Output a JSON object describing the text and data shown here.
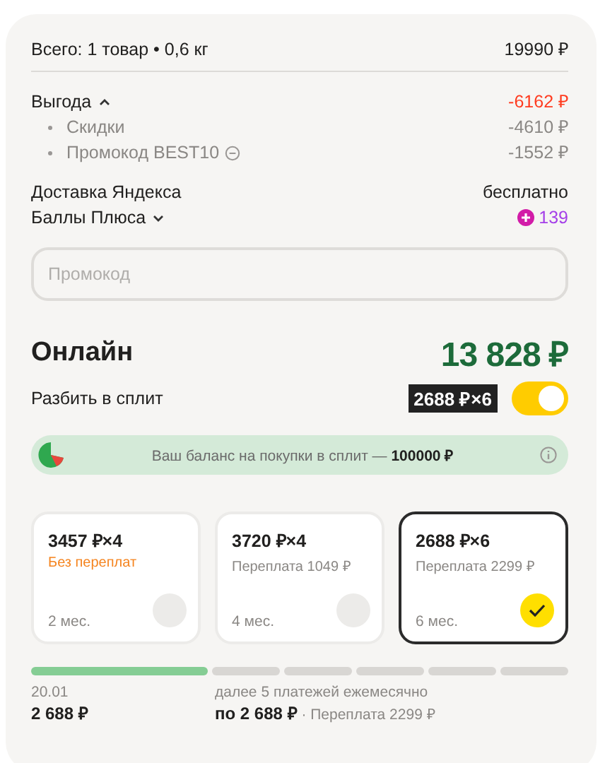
{
  "total": {
    "label": "Всего: 1 товар • 0,6 кг",
    "value": "19990 ₽"
  },
  "benefit": {
    "label": "Выгода",
    "expanded": true,
    "value": "-6162 ₽",
    "items": [
      {
        "label": "Скидки",
        "value": "-4610 ₽",
        "removable": false
      },
      {
        "label": "Промокод BEST10",
        "value": "-1552 ₽",
        "removable": true
      }
    ]
  },
  "delivery": {
    "label": "Доставка Яндекса",
    "value": "бесплатно"
  },
  "plus_points": {
    "label": "Баллы Плюса",
    "expanded": false,
    "value": "139"
  },
  "promo_field": {
    "placeholder": "Промокод"
  },
  "online": {
    "label": "Онлайн",
    "price": "13 828 ₽"
  },
  "split": {
    "label": "Разбить в сплит",
    "badge": "2688 ₽×6",
    "on": true
  },
  "balance": {
    "text": "Ваш баланс на покупки в сплит — **100000 ₽**"
  },
  "plans": [
    {
      "price": "3457 ₽×4",
      "note": "Без переплат",
      "kind": "no_overpay",
      "term": "2 мес.",
      "selected": false
    },
    {
      "price": "3720 ₽×4",
      "note": "Переплата 1049 ₽",
      "kind": "overpay",
      "term": "4 мес.",
      "selected": false
    },
    {
      "price": "2688 ₽×6",
      "note": "Переплата 2299 ₽",
      "kind": "overpay",
      "term": "6 мес.",
      "selected": true
    }
  ],
  "schedule": {
    "segments": [
      {
        "paid": true
      },
      {
        "paid": false
      },
      {
        "paid": false
      },
      {
        "paid": false
      },
      {
        "paid": false
      },
      {
        "paid": false
      }
    ],
    "first_date": "20.01",
    "first_amount": "2 688 ₽",
    "next_label": "далее 5 платежей ежемесячно",
    "next_amount": "**по 2 688 ₽** · Переплата 2299 ₽"
  }
}
